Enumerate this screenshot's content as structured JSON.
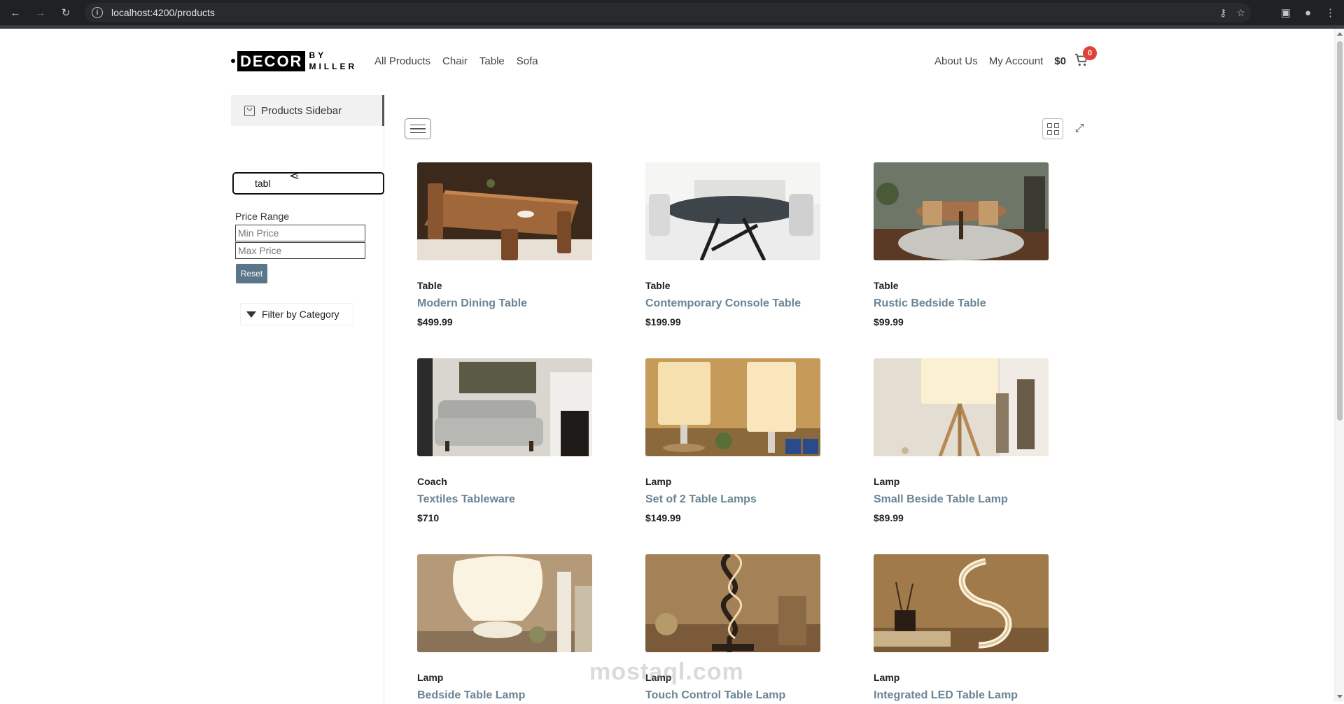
{
  "browser": {
    "url": "localhost:4200/products"
  },
  "header": {
    "logo_main": "DECOR",
    "logo_by": "BY",
    "logo_sub": "MILLER",
    "nav": [
      "All Products",
      "Chair",
      "Table",
      "Sofa"
    ],
    "about": "About Us",
    "account": "My Account",
    "cart_total": "$0",
    "cart_count": "0"
  },
  "sidebar": {
    "title": "Products Sidebar",
    "search_value": "tabl",
    "price_range_label": "Price Range",
    "min_placeholder": "Min Price",
    "max_placeholder": "Max Price",
    "reset_label": "Reset",
    "filter_label": "Filter by Category"
  },
  "products": [
    {
      "category": "Table",
      "name": "Modern Dining Table",
      "price": "$499.99"
    },
    {
      "category": "Table",
      "name": "Contemporary Console Table",
      "price": "$199.99"
    },
    {
      "category": "Table",
      "name": "Rustic Bedside Table",
      "price": "$99.99"
    },
    {
      "category": "Coach",
      "name": "Textiles Tableware",
      "price": "$710"
    },
    {
      "category": "Lamp",
      "name": "Set of 2 Table Lamps",
      "price": "$149.99"
    },
    {
      "category": "Lamp",
      "name": "Small Beside Table Lamp",
      "price": "$89.99"
    },
    {
      "category": "Lamp",
      "name": "Bedside Table Lamp",
      "price": ""
    },
    {
      "category": "Lamp",
      "name": "Touch Control Table Lamp",
      "price": ""
    },
    {
      "category": "Lamp",
      "name": "Integrated LED Table Lamp",
      "price": ""
    }
  ],
  "watermark": "mostaql.com",
  "colors": {
    "accent": "#6a8494",
    "reset_button": "#5a7688",
    "badge": "#e0413a"
  }
}
